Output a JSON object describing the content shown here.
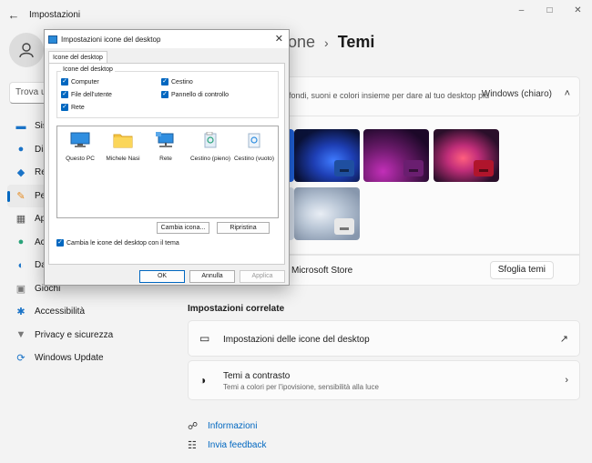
{
  "app": {
    "title": "Impostazioni",
    "back_icon": "←",
    "controls": [
      "–",
      "□",
      "✕"
    ]
  },
  "sidebar": {
    "search_placeholder": "Trova un",
    "items": [
      {
        "label": "Sis",
        "icon": "system-icon",
        "glyph": "▬",
        "color": "#1a73c7"
      },
      {
        "label": "Dis",
        "icon": "bluetooth-icon",
        "glyph": "●",
        "color": "#1a73c7"
      },
      {
        "label": "Re",
        "icon": "network-icon",
        "glyph": "◆",
        "color": "#1a73c7"
      },
      {
        "label": "Pe",
        "icon": "personalization-icon",
        "glyph": "✎",
        "color": "#e58a1f",
        "active": true
      },
      {
        "label": "Ap",
        "icon": "apps-icon",
        "glyph": "▦",
        "color": "#555"
      },
      {
        "label": "Ac",
        "icon": "accounts-icon",
        "glyph": "●",
        "color": "#2aa37a"
      },
      {
        "label": "Da",
        "icon": "time-language-icon",
        "glyph": "◐",
        "color": "#1a73c7"
      },
      {
        "label": "Giochi",
        "icon": "gaming-icon",
        "glyph": "▣",
        "color": "#777"
      },
      {
        "label": "Accessibilità",
        "icon": "accessibility-icon",
        "glyph": "✱",
        "color": "#1a73c7"
      },
      {
        "label": "Privacy e sicurezza",
        "icon": "shield-icon",
        "glyph": "▼",
        "color": "#777"
      },
      {
        "label": "Windows Update",
        "icon": "update-icon",
        "glyph": "⟳",
        "color": "#1a73c7"
      }
    ]
  },
  "header": {
    "parent": "one",
    "separator": "›",
    "current": "Temi"
  },
  "theme_section": {
    "description": "fondi, suoni e colori insieme per dare al tuo desktop più",
    "current_theme": "Windows (chiaro)",
    "chevron": "˄",
    "store_text": "l Microsoft Store",
    "browse_button": "Sfoglia temi"
  },
  "related": {
    "title": "Impostazioni correlate",
    "items": [
      {
        "title": "Impostazioni delle icone del desktop",
        "icon": "monitor-icon",
        "glyph": "▭",
        "end": "↗"
      },
      {
        "title": "Temi a contrasto",
        "subtitle": "Temi a colori per l'ipovisione, sensibilità alla luce",
        "icon": "contrast-icon",
        "glyph": "◑",
        "end": "›"
      }
    ]
  },
  "help": {
    "info": "Informazioni",
    "feedback": "Invia feedback"
  },
  "dialog": {
    "title": "Impostazioni icone del desktop",
    "close": "✕",
    "tab": "Icone del desktop",
    "group_label": "Icone del desktop",
    "checkboxes": [
      {
        "label": "Computer",
        "checked": true
      },
      {
        "label": "Cestino",
        "checked": true
      },
      {
        "label": "File dell'utente",
        "checked": true
      },
      {
        "label": "Pannello di controllo",
        "checked": true
      },
      {
        "label": "Rete",
        "checked": true
      }
    ],
    "icons": [
      {
        "label": "Questo PC",
        "icon": "this-pc-icon"
      },
      {
        "label": "Michele Nasi",
        "icon": "user-folder-icon"
      },
      {
        "label": "Rete",
        "icon": "network-icon"
      },
      {
        "label": "Cestino (pieno)",
        "icon": "recycle-bin-full-icon"
      },
      {
        "label": "Cestino (vuoto)",
        "icon": "recycle-bin-empty-icon"
      }
    ],
    "change_icon": "Cambia icona...",
    "restore": "Ripristina",
    "allow_themes": "Cambia le icone del desktop con il tema",
    "ok": "OK",
    "cancel": "Annulla",
    "apply": "Applica"
  }
}
